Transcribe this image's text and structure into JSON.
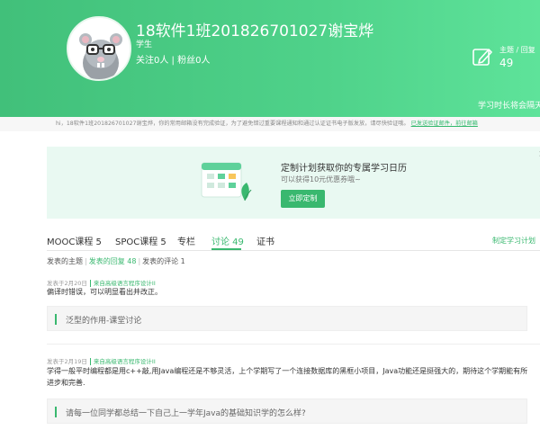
{
  "profile": {
    "name": "18软件1班201826701027谢宝烨",
    "role": "学生",
    "stats": "关注0人 | 粉丝0人",
    "posts_label": "主题 / 回复",
    "posts_count": "49",
    "study_rank": "学习时长将会隔天"
  },
  "notice": {
    "text": "hi，18软件1班201826701027谢宝烨，你的常用邮箱没有完成验证，为了避免错过重要课程通知和通过认证证书电子版发放，请尽快验证哦。",
    "link": "已发送验证邮件，前往邮箱"
  },
  "promo": {
    "title": "定制计划获取你的专属学习日历",
    "subtitle": "可以获得10元优惠券哦~",
    "button": "立即定制"
  },
  "tabs": [
    {
      "label": "MOOC课程 5",
      "active": false
    },
    {
      "label": "SPOC课程 5",
      "active": false
    },
    {
      "label": "专栏",
      "active": false
    },
    {
      "label": "讨论 49",
      "active": true
    },
    {
      "label": "证书",
      "active": false
    }
  ],
  "plan_link": "制定学习计划",
  "filters": {
    "topics": "发表的主题",
    "replies": "发表的回复 48",
    "comments": "发表的评论 1"
  },
  "items": [
    {
      "date": "发表于2月20日",
      "source": "来自高级语言程序设计II",
      "text": "偏译时错误，可以明显看出并改正。",
      "quote": "泛型的作用-课堂讨论"
    },
    {
      "date": "发表于2月19日",
      "source": "来自高级语言程序设计II",
      "text": "学得一般平时编程都是用c++敲,用Java编程还是不够灵活，上个学期写了一个连接数据库的黑框小项目，Java功能还是挺强大的，期待这个学期能有所进步和完善.",
      "quote": "请每一位同学都总结一下自己上一学年Java的基础知识学的怎么样?"
    }
  ]
}
